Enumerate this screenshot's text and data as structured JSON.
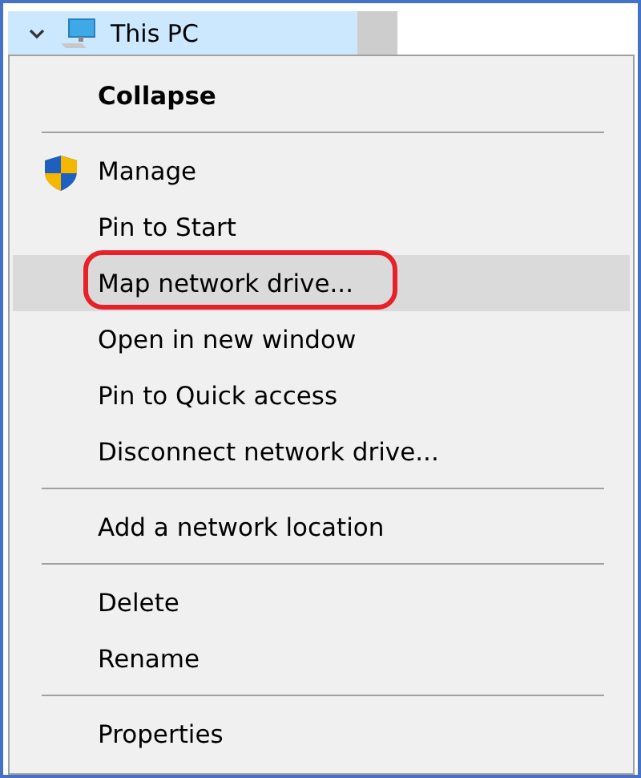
{
  "tree_row": {
    "label": "This PC",
    "expanded": true,
    "selected": true
  },
  "context_menu": [
    {
      "kind": "item",
      "label": "Collapse",
      "default": true,
      "highlighted": false,
      "circled": false
    },
    {
      "kind": "separator"
    },
    {
      "kind": "admin",
      "label": "Manage",
      "default": false,
      "highlighted": false,
      "circled": false
    },
    {
      "kind": "item",
      "label": "Pin to Start",
      "default": false,
      "highlighted": false,
      "circled": false
    },
    {
      "kind": "item",
      "label": "Map network drive...",
      "default": false,
      "highlighted": true,
      "circled": true
    },
    {
      "kind": "item",
      "label": "Open in new window",
      "default": false,
      "highlighted": false,
      "circled": false
    },
    {
      "kind": "item",
      "label": "Pin to Quick access",
      "default": false,
      "highlighted": false,
      "circled": false
    },
    {
      "kind": "item",
      "label": "Disconnect network drive...",
      "default": false,
      "highlighted": false,
      "circled": false
    },
    {
      "kind": "separator"
    },
    {
      "kind": "item",
      "label": "Add a network location",
      "default": false,
      "highlighted": false,
      "circled": false
    },
    {
      "kind": "separator"
    },
    {
      "kind": "item",
      "label": "Delete",
      "default": false,
      "highlighted": false,
      "circled": false
    },
    {
      "kind": "item",
      "label": "Rename",
      "default": false,
      "highlighted": false,
      "circled": false
    },
    {
      "kind": "separator"
    },
    {
      "kind": "item",
      "label": "Properties",
      "default": false,
      "highlighted": false,
      "circled": false
    }
  ]
}
